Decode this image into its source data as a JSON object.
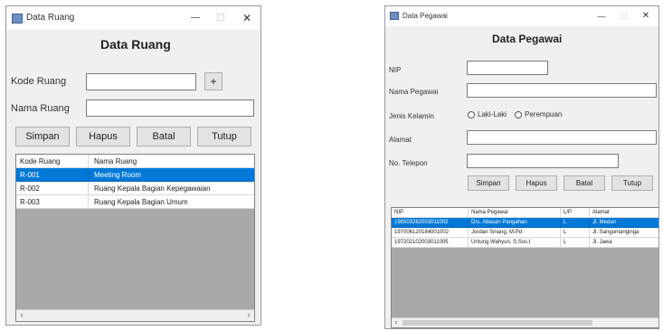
{
  "ruang": {
    "window_title": "Data Ruang",
    "controls": {
      "minimize": "—",
      "maximize": "☐",
      "close": "✕"
    },
    "heading": "Data Ruang",
    "labels": {
      "kode": "Kode Ruang",
      "nama": "Nama Ruang"
    },
    "inputs": {
      "kode_value": "",
      "nama_value": ""
    },
    "plus_button": "+",
    "buttons": {
      "simpan": "Simpan",
      "hapus": "Hapus",
      "batal": "Batal",
      "tutup": "Tutup"
    },
    "grid": {
      "headers": [
        "Kode Ruang",
        "Nama Ruang"
      ],
      "rows": [
        [
          "R-001",
          "Meeting Room"
        ],
        [
          "R-002",
          "Ruang Kepala Bagian Kepegawaian"
        ],
        [
          "R-003",
          "Ruang Kepala Bagian Umum"
        ]
      ]
    },
    "scroll": {
      "left": "‹",
      "right": "›"
    }
  },
  "pegawai": {
    "window_title": "Data Pegawai",
    "controls": {
      "minimize": "—",
      "maximize": "☐",
      "close": "✕"
    },
    "heading": "Data Pegawai",
    "labels": {
      "nip": "NIP",
      "nama": "Nama Pegawai",
      "jenis": "Jenis Kelamin",
      "alamat": "Alamat",
      "telepon": "No. Telepon"
    },
    "inputs": {
      "nip_value": "",
      "nama_value": "",
      "alamat_value": "",
      "telepon_value": ""
    },
    "radios": {
      "laki": "Laki-Laki",
      "perempuan": "Perempuan"
    },
    "buttons": {
      "simpan": "Simpan",
      "hapus": "Hapus",
      "batal": "Batal",
      "tutup": "Tutup"
    },
    "grid": {
      "headers": [
        "NIP",
        "Nama Pegawai",
        "L/P",
        "Alamat"
      ],
      "rows": [
        [
          "198503282003011002",
          "Drs. Abasan Pangahan",
          "L",
          "Jl. Medan"
        ],
        [
          "197006120184001002",
          "Jordan Sinang, M.Pd",
          "L",
          "Jl. Sangumanginga"
        ],
        [
          "197202102003011005",
          "Untung Wahyun, S.Sos.I",
          "L",
          "Jl. Jawa"
        ]
      ]
    },
    "scroll": {
      "left": "‹"
    }
  }
}
